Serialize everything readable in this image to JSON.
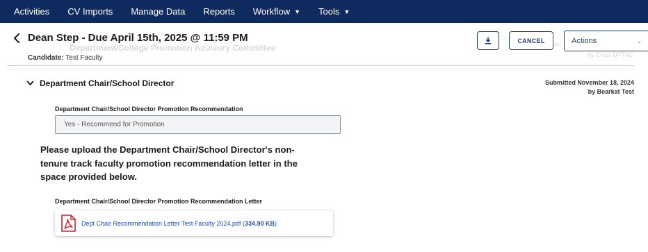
{
  "nav": {
    "items": [
      {
        "label": "Activities"
      },
      {
        "label": "CV Imports"
      },
      {
        "label": "Manage Data"
      },
      {
        "label": "Reports"
      },
      {
        "label": "Workflow",
        "caret": "▼"
      },
      {
        "label": "Tools",
        "caret": "▼"
      }
    ]
  },
  "header": {
    "title": "Dean Step - Due April 15th, 2025 @ 11:59 PM",
    "ghost_subtitle": "Department/College Promotion Advisory Committee",
    "ghost_right_1": "mi",
    "ghost_right_2": "by Chair DPTAC",
    "candidate_label": "Candidate:",
    "candidate_value": "Test Faculty",
    "cancel_label": "CANCEL",
    "actions_label": "Actions",
    "download_icon": "download-icon"
  },
  "section": {
    "title": "Department Chair/School Director",
    "submitted_line1": "Submitted November 18, 2024",
    "submitted_line2": "by Bearkat Test",
    "recommendation_label": "Department Chair/School Director Promotion Recommendation",
    "recommendation_value": "Yes - Recommend for Promotion",
    "instructions": "Please upload the Department Chair/School Director's non-tenure track faculty promotion recommendation letter in the space provided below.",
    "letter_label": "Department Chair/School Director Promotion Recommendation Letter",
    "file_name": "Dept Chair Recommendation Letter Test Faculty 2024.pdf",
    "file_size_open": " (",
    "file_size": "334.90 KB",
    "file_size_close": ")"
  },
  "colors": {
    "nav_bg": "#0e2a5e",
    "accent": "#1d3c78",
    "link": "#1f4fb8",
    "pdf_red": "#d0202e"
  }
}
